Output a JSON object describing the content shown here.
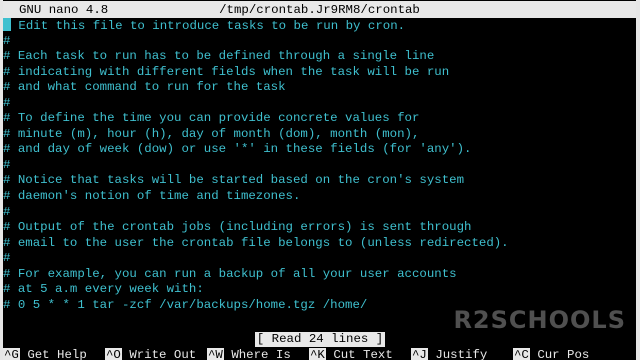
{
  "titlebar": {
    "app": "GNU nano 4.8",
    "file": "/tmp/crontab.Jr9RM8/crontab"
  },
  "lines": [
    " Edit this file to introduce tasks to be run by cron.",
    "#",
    "# Each task to run has to be defined through a single line",
    "# indicating with different fields when the task will be run",
    "# and what command to run for the task",
    "#",
    "# To define the time you can provide concrete values for",
    "# minute (m), hour (h), day of month (dom), month (mon),",
    "# and day of week (dow) or use '*' in these fields (for 'any').",
    "#",
    "# Notice that tasks will be started based on the cron's system",
    "# daemon's notion of time and timezones.",
    "#",
    "# Output of the crontab jobs (including errors) is sent through",
    "# email to the user the crontab file belongs to (unless redirected).",
    "#",
    "# For example, you can run a backup of all your user accounts",
    "# at 5 a.m every week with:",
    "# 0 5 * * 1 tar -zcf /var/backups/home.tgz /home/"
  ],
  "status": "[ Read 24 lines ]",
  "watermark": "R2SCHOOLS",
  "shortcuts": [
    {
      "key": "^G",
      "label": "Get Help"
    },
    {
      "key": "^O",
      "label": "Write Out"
    },
    {
      "key": "^W",
      "label": "Where Is"
    },
    {
      "key": "^K",
      "label": "Cut Text"
    },
    {
      "key": "^J",
      "label": "Justify"
    },
    {
      "key": "^C",
      "label": "Cur Pos"
    }
  ],
  "colors": {
    "text": "#3fc0cf",
    "background": "#000000",
    "bar": "#e8e8e8"
  }
}
